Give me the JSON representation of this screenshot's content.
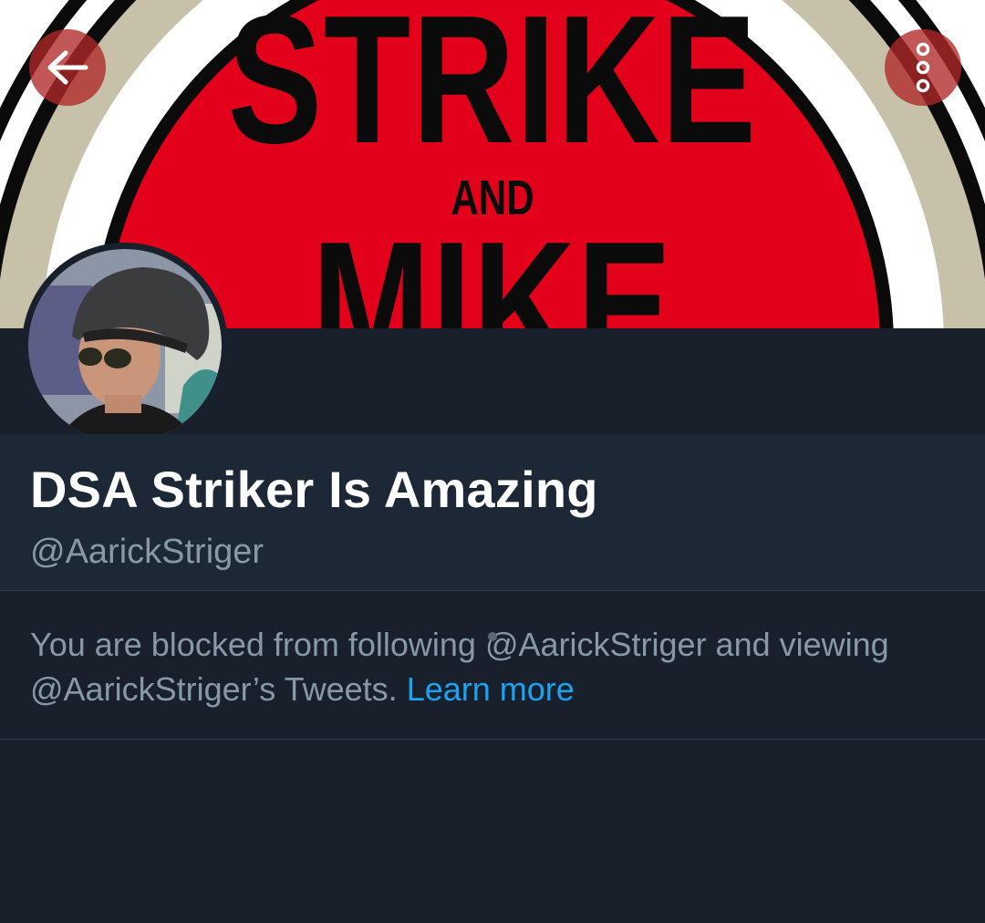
{
  "banner": {
    "word_strike": "STRIKE",
    "word_and": "AND",
    "word_mike": "MIKE",
    "colors": {
      "red": "#e3001b",
      "white": "#ffffff",
      "tan": "#c6c1a8",
      "black": "#0b0b0b"
    }
  },
  "header": {
    "back_icon": "arrow-left-icon",
    "more_icon": "more-vertical-icon"
  },
  "profile": {
    "display_name": "DSA Striker Is Amazing",
    "handle": "@AarickStriger",
    "avatar_icon": "avatar-photo"
  },
  "blocked_notice": {
    "text": "You are blocked from following @AarickStriger and viewing @AarickStriger’s Tweets.",
    "link_label": "Learn more"
  },
  "theme": {
    "background": "#18212b",
    "name_section_bg": "#1c2836",
    "muted_text": "#8899a6",
    "link": "#1da1f2"
  }
}
